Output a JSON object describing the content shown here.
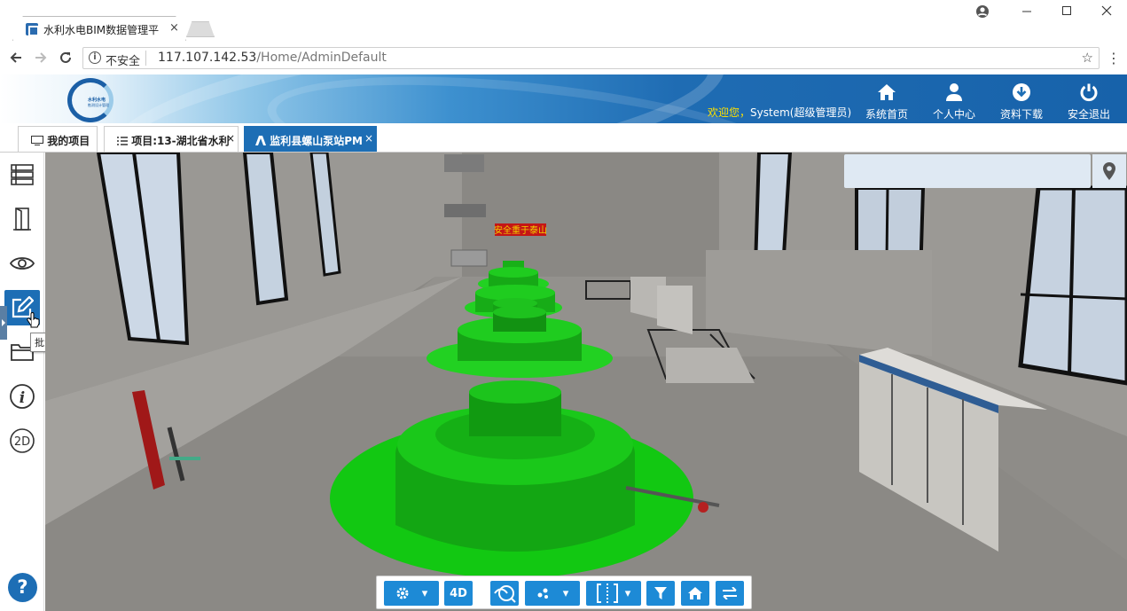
{
  "browser": {
    "tab_title": "水利水电BIM数据管理平",
    "tab_close": "×",
    "insecure_label": "不安全",
    "url_host": "117.107.142.53",
    "url_path": "/Home/AdminDefault"
  },
  "header": {
    "logo_line1": "水利水电",
    "logo_line2": "勘测设计管理",
    "welcome_prefix": "欢迎您，",
    "welcome_user": "System(超级管理员)",
    "nav": [
      {
        "label": "系统首页",
        "icon": "home-icon"
      },
      {
        "label": "个人中心",
        "icon": "user-icon"
      },
      {
        "label": "资料下载",
        "icon": "download-icon"
      },
      {
        "label": "安全退出",
        "icon": "power-icon"
      }
    ]
  },
  "project_tabs": [
    {
      "label": "我的项目",
      "icon": "monitor-icon"
    },
    {
      "label": "项目:13-湖北省水利",
      "icon": "list-icon",
      "close": "×"
    },
    {
      "label": "监利县螺山泵站PM",
      "icon": "model-icon",
      "close": "×",
      "active": true
    }
  ],
  "sidebar": {
    "items": [
      {
        "name": "layers-icon"
      },
      {
        "name": "door-icon"
      },
      {
        "name": "eye-icon"
      },
      {
        "name": "annotate-icon",
        "active": true
      },
      {
        "name": "folder-icon"
      },
      {
        "name": "info-icon"
      },
      {
        "name": "2d-icon",
        "label": "2D"
      }
    ],
    "tooltip": "批注",
    "help_label": "?"
  },
  "viewport": {
    "sign_text": "安全重于泰山"
  },
  "toolbar": {
    "buttons": [
      {
        "name": "settings-icon"
      },
      {
        "name": "4d",
        "label": "4D"
      },
      {
        "name": "walk-icon"
      },
      {
        "name": "points-icon"
      },
      {
        "name": "section-icon"
      },
      {
        "name": "filter-icon"
      },
      {
        "name": "home-icon"
      },
      {
        "name": "swap-icon"
      }
    ]
  },
  "colors": {
    "accent": "#1d6eb5",
    "toolbar_button": "#1d8ad6",
    "generator_green": "#1fcc1f",
    "welcome_highlight": "#ffe100"
  }
}
